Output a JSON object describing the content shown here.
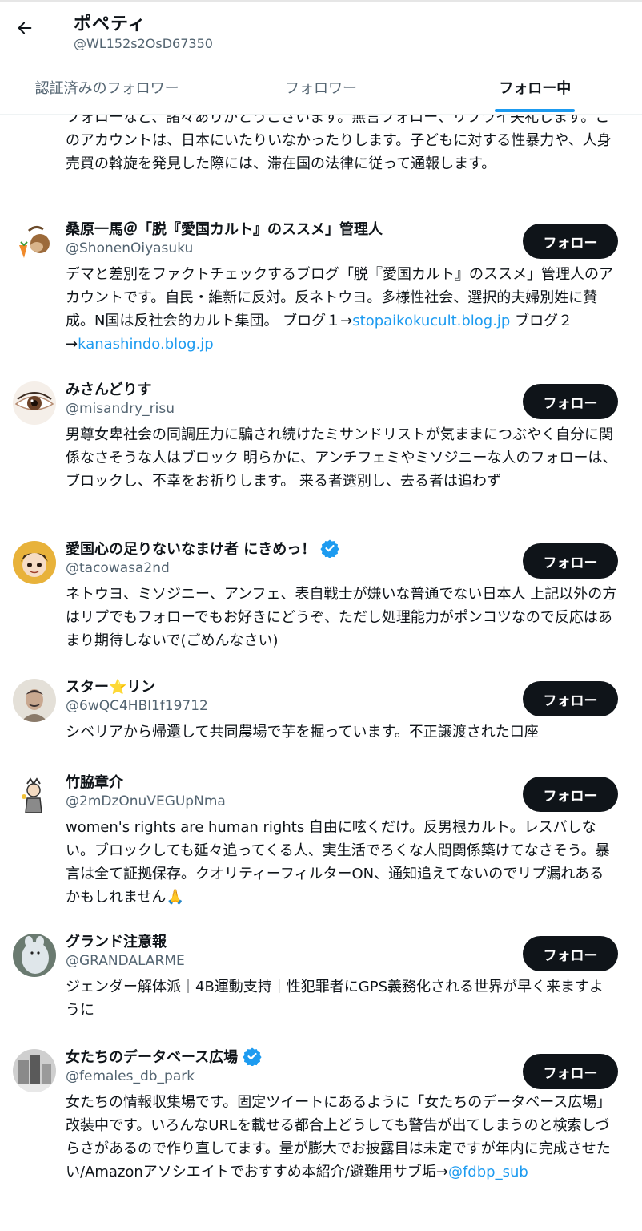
{
  "header": {
    "name": "ポペティ",
    "handle": "@WL152s2OsD67350"
  },
  "tabs": [
    {
      "label": "認証済みのフォロワー"
    },
    {
      "label": "フォロワー"
    },
    {
      "label": "フォロー中",
      "active": true
    }
  ],
  "partial_bio": "フォローなど、諸々ありがとうございます。無言フォロー、リプライ失礼します。このアカウントは、日本にいたりいなかったりします。子どもに対する性暴力や、人身売買の斡旋を発見した際には、滞在国の法律に従って通報します。",
  "follow_label": "フォロー",
  "users": [
    {
      "name": "桑原一馬＠「脱『愛国カルト』のススメ」管理人",
      "handle": "@ShonenOiyasuku",
      "verified": false,
      "bio_text": "デマと差別をファクトチェックするブログ「脱『愛国カルト』のススメ」管理人のアカウントです。自民・維新に反対。反ネトウヨ。多様性社会、選択的夫婦別姓に賛成。N国は反社会的カルト集団。 ブログ１→",
      "link1": "stopaikokucult.blog.jp",
      "mid_text": " ブログ２→",
      "link2": "kanashindo.blog.jp"
    },
    {
      "name": "みさんどりす",
      "handle": "@misandry_risu",
      "verified": false,
      "bio_text": "男尊女卑社会の同調圧力に騙され続けたミサンドリストが気ままにつぶやく自分に関係なさそうな人はブロック 明らかに、アンチフェミやミソジニーな人のフォローは、ブロックし、不幸をお祈りします。 来る者選別し、去る者は追わず"
    },
    {
      "name": "愛国心の足りないなまけ者 にきめっ！",
      "handle": "@tacowasa2nd",
      "verified": true,
      "bio_text": "ネトウヨ、ミソジニー、アンフェ、表自戦士が嫌いな普通でない日本人 上記以外の方はリプでもフォローでもお好きにどうぞ、ただし処理能力がポンコツなので反応はあまり期待しないで(ごめんなさい)"
    },
    {
      "name": "スター⭐リン",
      "handle": "@6wQC4HBl1f19712",
      "verified": false,
      "bio_text": "シベリアから帰還して共同農場で芋を掘っています。不正譲渡された口座"
    },
    {
      "name": "竹脇章介",
      "handle": "@2mDzOnuVEGUpNma",
      "verified": false,
      "bio_text": "women's rights are human rights 自由に呟くだけ。反男根カルト。レスバしない。ブロックしても延々追ってくる人、実生活でろくな人間関係築けてなさそう。暴言は全て証拠保存。クオリティーフィルターON、通知追えてないのでリプ漏れあるかもしれません🙏"
    },
    {
      "name": "グランド注意報",
      "handle": "@GRANDALARME",
      "verified": false,
      "bio_text": "ジェンダー解体派｜4B運動支持｜性犯罪者にGPS義務化される世界が早く来ますように"
    },
    {
      "name": "女たちのデータベース広場",
      "handle": "@females_db_park",
      "verified": true,
      "bio_text": "女たちの情報収集場です。固定ツイートにあるように「女たちのデータベース広場」改装中です。いろんなURLを載せる都合上どうしても警告が出てしまうのと検索しづらさがあるので作り直してます。量が膨大でお披露目は未定ですが年内に完成させたい/Amazonアソシエイトでおすすめ本紹介/避難用サブ垢→",
      "link1": "@fdbp_sub"
    }
  ],
  "colors": {
    "accent": "#1d9bf0",
    "text": "#0f1419",
    "secondary": "#536471",
    "button": "#0f1419"
  }
}
